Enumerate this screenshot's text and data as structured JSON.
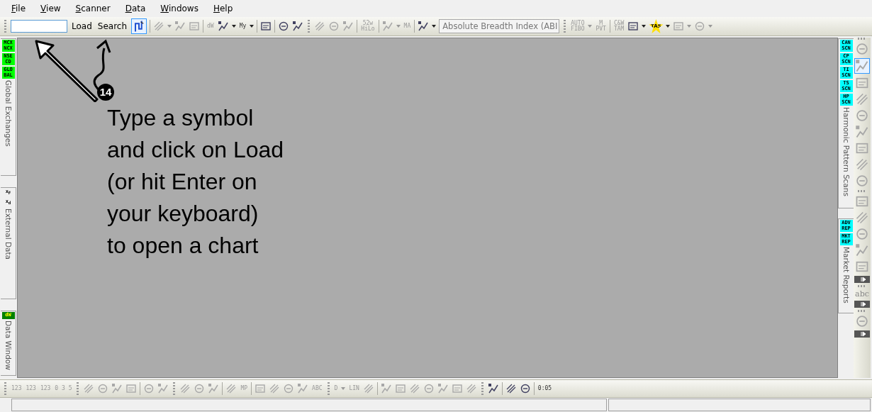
{
  "menu": [
    "File",
    "View",
    "Scanner",
    "Data",
    "Windows",
    "Help"
  ],
  "toolbar": [
    {
      "kind": "grip"
    },
    {
      "kind": "field"
    },
    {
      "kind": "button",
      "label": "Load"
    },
    {
      "kind": "button",
      "label": "Search"
    },
    {
      "kind": "toggle",
      "on": true
    },
    {
      "kind": "sep"
    },
    {
      "kind": "icon",
      "disabled": true
    },
    {
      "kind": "caret",
      "disabled": true
    },
    {
      "kind": "icon",
      "disabled": true
    },
    {
      "kind": "icon",
      "disabled": true
    },
    {
      "kind": "sep"
    },
    {
      "kind": "text_icon",
      "label": "dW",
      "disabled": true
    },
    {
      "kind": "icon",
      "disabled": false
    },
    {
      "kind": "caret",
      "disabled": false
    },
    {
      "kind": "text_icon",
      "label": "My",
      "disabled": false
    },
    {
      "kind": "caret",
      "disabled": false
    },
    {
      "kind": "sep"
    },
    {
      "kind": "icon",
      "disabled": false
    },
    {
      "kind": "sep"
    },
    {
      "kind": "icon",
      "disabled": false
    },
    {
      "kind": "icon",
      "disabled": false
    },
    {
      "kind": "grip"
    },
    {
      "kind": "icon",
      "disabled": true
    },
    {
      "kind": "icon",
      "disabled": true
    },
    {
      "kind": "icon",
      "disabled": true
    },
    {
      "kind": "sep"
    },
    {
      "kind": "text_icon",
      "label": "52w\nHiLo",
      "disabled": true
    },
    {
      "kind": "sep"
    },
    {
      "kind": "icon",
      "disabled": true
    },
    {
      "kind": "caret",
      "disabled": true
    },
    {
      "kind": "text_icon",
      "label": "MA",
      "disabled": true
    },
    {
      "kind": "sep"
    },
    {
      "kind": "icon",
      "disabled": false
    },
    {
      "kind": "caret",
      "disabled": false
    },
    {
      "kind": "dropdown",
      "value": "Absolute Breadth Index (ABI"
    },
    {
      "kind": "grip"
    },
    {
      "kind": "text_icon",
      "label": "AUTO\nFIBO",
      "disabled": true
    },
    {
      "kind": "caret",
      "disabled": true
    },
    {
      "kind": "text_icon",
      "label": "M\nPVT",
      "disabled": true
    },
    {
      "kind": "sep"
    },
    {
      "kind": "text_icon",
      "label": "C&W\nTAM",
      "disabled": true
    },
    {
      "kind": "icon",
      "disabled": false
    },
    {
      "kind": "caret",
      "disabled": false
    },
    {
      "kind": "star_text",
      "label": "TAS",
      "disabled": false
    },
    {
      "kind": "caret",
      "disabled": false
    },
    {
      "kind": "icon",
      "disabled": true
    },
    {
      "kind": "caret",
      "disabled": true
    },
    {
      "kind": "icon",
      "disabled": true
    },
    {
      "kind": "caret",
      "disabled": true
    }
  ],
  "left_panel": [
    {
      "title": "Global Exchanges",
      "badges": [
        {
          "label": "MCX\nNCX",
          "color": "#00ff00"
        },
        {
          "label": "NSE\nCD",
          "color": "#00ff00"
        },
        {
          "label": "GLO\nBAL",
          "color": "#00ff00"
        }
      ]
    },
    {
      "title": "External Data",
      "badges": [
        {
          "label": "x$_{F}$",
          "color": "#f0f0f0"
        },
        {
          "label": "x$_{d}$",
          "color": "#f0f0f0"
        }
      ]
    },
    {
      "title": "Data Window",
      "badges": [
        {
          "label": "dW",
          "color": "#008000"
        }
      ]
    }
  ],
  "annotation": {
    "number": "14",
    "text": "Type a symbol\nand click on Load\n(or hit Enter on\nyour keyboard)\nto open a chart"
  },
  "right_panel": [
    {
      "title": "Harmonic Pattern Scans",
      "badges": [
        {
          "label": "CAN\nSCN",
          "color": "#00ffff"
        },
        {
          "label": "CP\nSCN",
          "color": "#00ffff"
        },
        {
          "label": "TI\nSCN",
          "color": "#00ffff"
        },
        {
          "label": "TS\nSCN",
          "color": "#00ffff"
        },
        {
          "label": "HP\nSCN",
          "color": "#00ffff"
        }
      ]
    },
    {
      "title": "Market Reports",
      "badges": [
        {
          "label": "ADV\nREP",
          "color": "#00ffff"
        },
        {
          "label": "MKT\nREP",
          "color": "#00ffff"
        }
      ]
    }
  ],
  "drawing_tools": [
    {
      "kind": "grip"
    },
    {
      "kind": "tool",
      "selected": false
    },
    {
      "kind": "tool",
      "selected": true
    },
    {
      "kind": "tool",
      "selected": false
    },
    {
      "kind": "tool",
      "selected": false
    },
    {
      "kind": "tool",
      "selected": false
    },
    {
      "kind": "tool",
      "selected": false
    },
    {
      "kind": "tool",
      "selected": false
    },
    {
      "kind": "tool",
      "selected": false
    },
    {
      "kind": "tool",
      "selected": false
    },
    {
      "kind": "grip"
    },
    {
      "kind": "tool",
      "selected": false
    },
    {
      "kind": "tool",
      "selected": false
    },
    {
      "kind": "tool",
      "selected": false
    },
    {
      "kind": "tool",
      "selected": false
    },
    {
      "kind": "tool",
      "selected": false
    },
    {
      "kind": "expander"
    },
    {
      "kind": "grip"
    },
    {
      "kind": "text_tool",
      "label": "abc",
      "selected": false
    },
    {
      "kind": "expander"
    },
    {
      "kind": "grip"
    },
    {
      "kind": "tool",
      "selected": false
    },
    {
      "kind": "expander"
    }
  ],
  "bottom_toolbar": [
    {
      "kind": "grip"
    },
    {
      "kind": "text_icon",
      "label": "123",
      "disabled": true
    },
    {
      "kind": "text_icon",
      "label": "123",
      "disabled": true
    },
    {
      "kind": "text_icon",
      "label": "123",
      "disabled": true
    },
    {
      "kind": "text_icon",
      "label": "0 3 5",
      "disabled": true
    },
    {
      "kind": "grip"
    },
    {
      "kind": "icon",
      "disabled": true
    },
    {
      "kind": "icon",
      "disabled": true
    },
    {
      "kind": "icon",
      "disabled": true
    },
    {
      "kind": "icon",
      "disabled": true
    },
    {
      "kind": "sep"
    },
    {
      "kind": "icon",
      "disabled": true
    },
    {
      "kind": "icon",
      "disabled": true
    },
    {
      "kind": "grip"
    },
    {
      "kind": "icon",
      "disabled": true
    },
    {
      "kind": "icon",
      "disabled": true
    },
    {
      "kind": "icon",
      "disabled": true
    },
    {
      "kind": "sep"
    },
    {
      "kind": "icon",
      "disabled": true
    },
    {
      "kind": "text_icon",
      "label": "MP",
      "disabled": true
    },
    {
      "kind": "sep"
    },
    {
      "kind": "icon",
      "disabled": true
    },
    {
      "kind": "icon",
      "disabled": true
    },
    {
      "kind": "icon",
      "disabled": true
    },
    {
      "kind": "icon",
      "disabled": true
    },
    {
      "kind": "text_icon",
      "label": "ABC",
      "disabled": true
    },
    {
      "kind": "grip"
    },
    {
      "kind": "text_icon",
      "label": "D",
      "disabled": true
    },
    {
      "kind": "caret",
      "disabled": true
    },
    {
      "kind": "text_icon",
      "label": "LIN",
      "disabled": true
    },
    {
      "kind": "icon",
      "disabled": true
    },
    {
      "kind": "sep"
    },
    {
      "kind": "icon",
      "disabled": true
    },
    {
      "kind": "icon",
      "disabled": true
    },
    {
      "kind": "icon",
      "disabled": true
    },
    {
      "kind": "icon",
      "disabled": true
    },
    {
      "kind": "icon",
      "disabled": true
    },
    {
      "kind": "icon",
      "disabled": true
    },
    {
      "kind": "icon",
      "disabled": true
    },
    {
      "kind": "grip"
    },
    {
      "kind": "icon",
      "disabled": false
    },
    {
      "kind": "sep"
    },
    {
      "kind": "icon",
      "disabled": false
    },
    {
      "kind": "icon",
      "disabled": false
    },
    {
      "kind": "sep"
    },
    {
      "kind": "text_icon",
      "label": "0:05",
      "disabled": false
    }
  ]
}
